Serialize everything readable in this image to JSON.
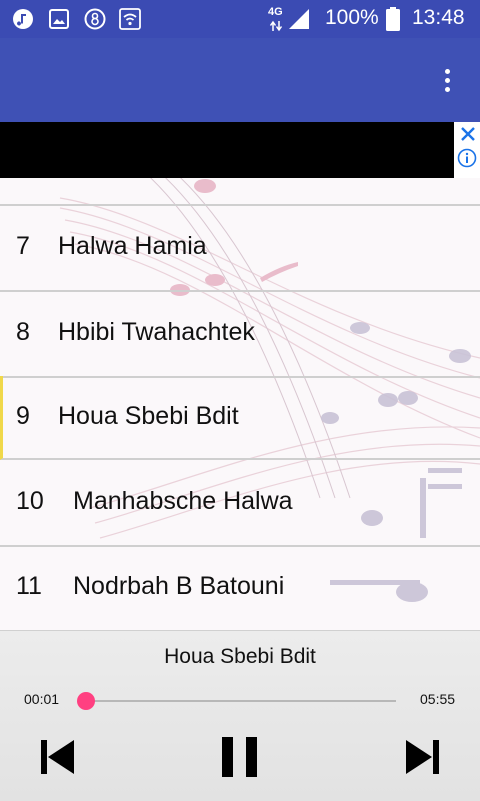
{
  "status_bar": {
    "network": "4G",
    "battery": "100%",
    "time": "13:48",
    "icons": [
      "music-note-icon",
      "image-icon",
      "counter-icon",
      "wifi-icon",
      "data-arrows-icon",
      "signal-icon",
      "battery-icon"
    ]
  },
  "app_bar": {
    "menu_icon": "more-vert-icon",
    "color": "#3f51b5"
  },
  "ad": {
    "close_icon": "close-icon",
    "info_icon": "info-icon"
  },
  "playlist": {
    "tracks": [
      {
        "number": "7",
        "title": "Halwa Hamia"
      },
      {
        "number": "8",
        "title": "Hbibi Twahachtek"
      },
      {
        "number": "9",
        "title": "Houa Sbebi Bdit"
      },
      {
        "number": "10",
        "title": "Manhabsche Halwa"
      },
      {
        "number": "11",
        "title": "Nodrbah B Batouni"
      }
    ],
    "active_index": 2
  },
  "player": {
    "now_playing": "Houa Sbebi Bdit",
    "elapsed": "00:01",
    "duration": "05:55",
    "progress": 0.003,
    "accent": "#ff4081",
    "controls": [
      "skip-previous-icon",
      "pause-icon",
      "skip-next-icon"
    ]
  }
}
